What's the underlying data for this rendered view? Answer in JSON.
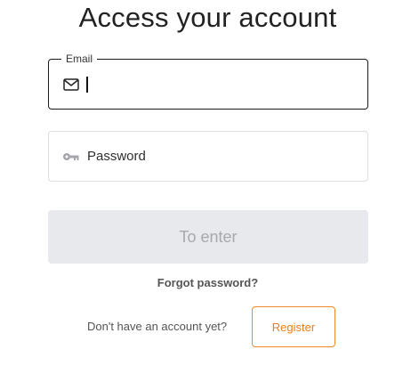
{
  "title": "Access your account",
  "email": {
    "label": "Email",
    "value": "",
    "icon": "mail-icon"
  },
  "password": {
    "placeholder": "Password",
    "value": "",
    "icon": "key-icon"
  },
  "enter_button": {
    "label": "To enter",
    "disabled": true
  },
  "forgot_label": "Forgot password?",
  "register": {
    "prompt": "Don't have an account yet?",
    "button_label": "Register"
  },
  "colors": {
    "accent": "#f07d17",
    "disabled_bg": "#e8e9ec",
    "disabled_text": "#a6a8ad",
    "focused_border": "#1a1a1a",
    "idle_border": "#dcdde0"
  }
}
